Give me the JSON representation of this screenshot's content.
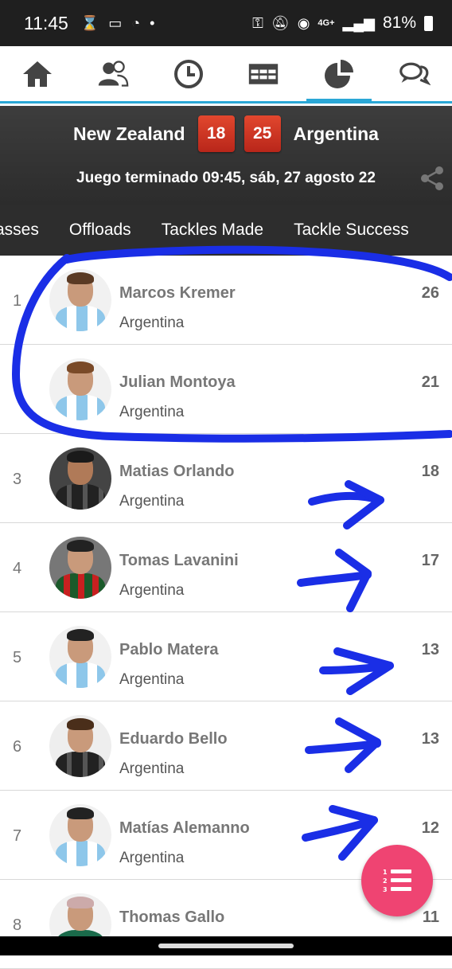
{
  "status_bar": {
    "time": "11:45",
    "network": "4G+",
    "battery": "81%"
  },
  "nav_tabs": [
    {
      "icon": "home-icon"
    },
    {
      "icon": "players-icon"
    },
    {
      "icon": "clock-icon"
    },
    {
      "icon": "table-icon"
    },
    {
      "icon": "pie-chart-icon",
      "active": true
    },
    {
      "icon": "chat-icon"
    }
  ],
  "match": {
    "home_team": "New Zealand",
    "home_score": "18",
    "away_score": "25",
    "away_team": "Argentina",
    "status": "Juego terminado 09:45, sáb, 27 agosto 22"
  },
  "stat_tabs": [
    "asses",
    "Offloads",
    "Tackles Made",
    "Tackle Success"
  ],
  "players": [
    {
      "rank": "1",
      "name": "Marcos Kremer",
      "country": "Argentina",
      "value": "26",
      "kit": "blue"
    },
    {
      "rank": "",
      "name": "Julian Montoya",
      "country": "Argentina",
      "value": "21",
      "kit": "blue"
    },
    {
      "rank": "3",
      "name": "Matias Orlando",
      "country": "Argentina",
      "value": "18",
      "kit": "dark"
    },
    {
      "rank": "4",
      "name": "Tomas Lavanini",
      "country": "Argentina",
      "value": "17",
      "kit": "red"
    },
    {
      "rank": "5",
      "name": "Pablo Matera",
      "country": "Argentina",
      "value": "13",
      "kit": "blue"
    },
    {
      "rank": "6",
      "name": "Eduardo Bello",
      "country": "Argentina",
      "value": "13",
      "kit": "dark"
    },
    {
      "rank": "7",
      "name": "Matías Alemanno",
      "country": "Argentina",
      "value": "12",
      "kit": "blue"
    },
    {
      "rank": "8",
      "name": "Thomas Gallo",
      "country": "",
      "value": "11",
      "kit": "blue"
    }
  ],
  "colors": {
    "accent": "#2aa7d6",
    "score_bg": "#c9301f",
    "fab": "#ef4472",
    "annotation": "#1a2ee6"
  }
}
